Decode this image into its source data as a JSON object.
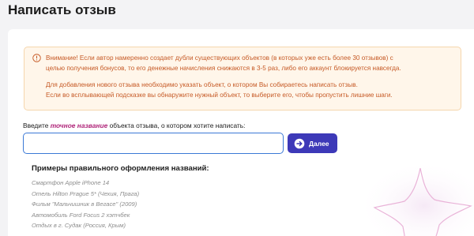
{
  "header": {
    "title": "Написать отзыв"
  },
  "warning": {
    "icon": "alert-circle-icon",
    "lines": [
      "Внимание! Если автор намеренно создает дубли существующих объектов (в которых уже есть более 30 отзывов) с",
      "целью получения бонусов, то его денежные начисления снижаются в 3-5 раз, либо его аккаунт блокируется навсегда.",
      "Для добавления нового отзыва необходимо указать объект, о котором Вы собираетесь написать отзыв.",
      "Если во всплывающей подсказке вы обнаружите нужный объект, то выберите его, чтобы пропустить лишние шаги."
    ],
    "text_color": "#c65a26",
    "background": "#fff6ea"
  },
  "form": {
    "label_prefix": "Введите",
    "label_accent": "точное название",
    "label_suffix": "объекта отзыва, о котором хотите написать:",
    "input_value": "",
    "input_placeholder": "",
    "button_label": "Далее",
    "button_icon": "arrow-right-circle-icon",
    "button_color": "#3d39b8",
    "accent_color": "#b0267a"
  },
  "examples": {
    "title": "Примеры правильного оформления названий:",
    "items": [
      "Смартфон Apple iPhone 14",
      "Отель Hilton Prague 5* (Чехия, Прага)",
      "Фильм \"Мальчишник в Вегасе\" (2009)",
      "Автомобиль Ford Focus 2 хэтчбек",
      "Отдых в г. Судак (Россия, Крым)"
    ]
  }
}
